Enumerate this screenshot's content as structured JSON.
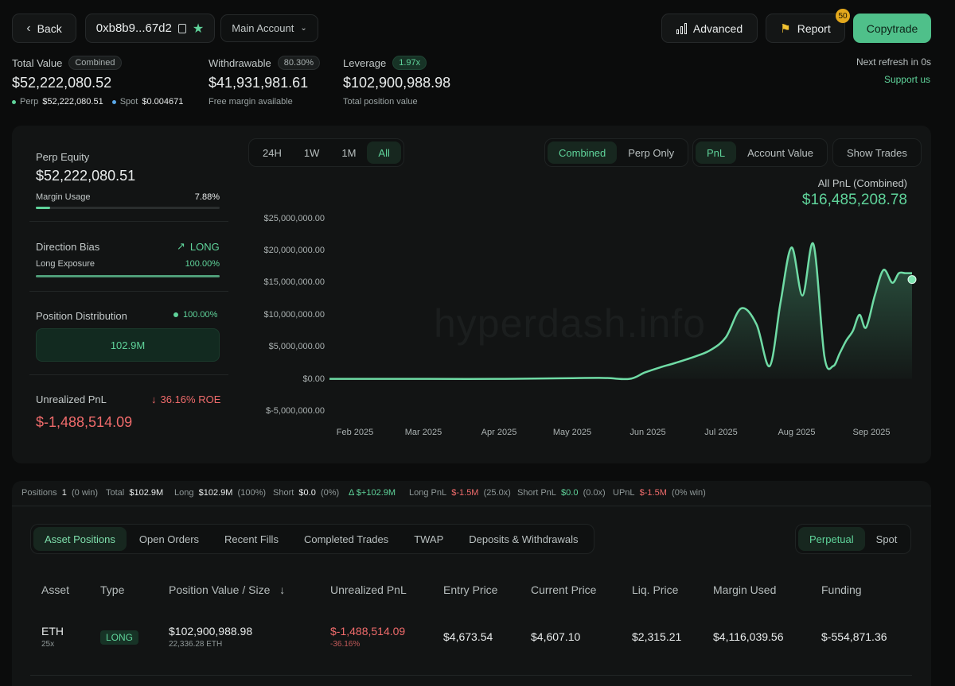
{
  "header": {
    "back_label": "Back",
    "address": "0xb8b9...67d2",
    "account_select": "Main Account",
    "advanced_label": "Advanced",
    "report_label": "Report",
    "report_badge": "50",
    "copytrade_label": "Copytrade",
    "next_refresh": "Next refresh in 0s",
    "support": "Support us"
  },
  "summary": {
    "total_value_label": "Total Value",
    "total_value_tag": "Combined",
    "total_value": "$52,222,080.52",
    "perp_label": "Perp",
    "perp_value": "$52,222,080.51",
    "spot_label": "Spot",
    "spot_value": "$0.004671",
    "withdrawable_label": "Withdrawable",
    "withdrawable_pct": "80.30%",
    "withdrawable_value": "$41,931,981.61",
    "withdrawable_sub": "Free margin available",
    "leverage_label": "Leverage",
    "leverage_tag": "1.97x",
    "leverage_value": "$102,900,988.98",
    "leverage_sub": "Total position value"
  },
  "left_panel": {
    "perp_equity_label": "Perp Equity",
    "perp_equity_value": "$52,222,080.51",
    "margin_usage_label": "Margin Usage",
    "margin_usage_value": "7.88%",
    "margin_usage_fraction": 0.0788,
    "direction_bias_label": "Direction Bias",
    "direction_bias_value": "LONG",
    "long_exposure_label": "Long Exposure",
    "long_exposure_value": "100.00%",
    "long_exposure_fraction": 1.0,
    "position_dist_label": "Position Distribution",
    "position_dist_pct": "100.00%",
    "position_dist_value": "102.9M",
    "upnl_label": "Unrealized PnL",
    "upnl_roe": "36.16% ROE",
    "upnl_value": "$-1,488,514.09"
  },
  "chart_controls": {
    "ranges": [
      "24H",
      "1W",
      "1M",
      "All"
    ],
    "active_range": "All",
    "modes": [
      "Combined",
      "Perp Only"
    ],
    "active_mode": "Combined",
    "metrics": [
      "PnL",
      "Account Value"
    ],
    "active_metric": "PnL",
    "show_trades": "Show Trades"
  },
  "chart_data": {
    "type": "area",
    "title": "All PnL (Combined)",
    "headline_value": "$16,485,208.78",
    "watermark": "hyperdash.info",
    "ylim": [
      -5000000,
      25000000
    ],
    "y_ticks": [
      "$25,000,000.00",
      "$20,000,000.00",
      "$15,000,000.00",
      "$10,000,000.00",
      "$5,000,000.00",
      "$0.00",
      "$-5,000,000.00"
    ],
    "x_ticks": [
      "Feb 2025",
      "Mar 2025",
      "Apr 2025",
      "May 2025",
      "Jun 2025",
      "Jul 2025",
      "Aug 2025",
      "Sep 2025"
    ],
    "series": [
      {
        "x": [
          "2025-01-15",
          "2025-02-01",
          "2025-03-01",
          "2025-04-01",
          "2025-05-01",
          "2025-05-20",
          "2025-06-01",
          "2025-06-08",
          "2025-06-15",
          "2025-06-22",
          "2025-07-01",
          "2025-07-08",
          "2025-07-15",
          "2025-07-22",
          "2025-07-29",
          "2025-08-04",
          "2025-08-09",
          "2025-08-14",
          "2025-08-19",
          "2025-08-24",
          "2025-08-29",
          "2025-09-02",
          "2025-09-05",
          "2025-09-08",
          "2025-09-11",
          "2025-09-14",
          "2025-09-17",
          "2025-09-21",
          "2025-09-25",
          "2025-09-29",
          "2025-10-02",
          "2025-10-05",
          "2025-10-08"
        ],
        "values": [
          0,
          0,
          0,
          0,
          100000,
          150000,
          0,
          1000000,
          1800000,
          2500000,
          3500000,
          4500000,
          6500000,
          11000000,
          8500000,
          2000000,
          12000000,
          20500000,
          13000000,
          21000000,
          3500000,
          2000000,
          4000000,
          6000000,
          7500000,
          10000000,
          8000000,
          13000000,
          17000000,
          15000000,
          16485208.78,
          16485208.78,
          16485208.78
        ]
      }
    ]
  },
  "positions_bar": {
    "positions_label": "Positions",
    "positions_value": "1",
    "positions_sub": "(0 win)",
    "total_label": "Total",
    "total_value": "$102.9M",
    "long_label": "Long",
    "long_value": "$102.9M",
    "long_sub": "(100%)",
    "short_label": "Short",
    "short_value": "$0.0",
    "short_sub": "(0%)",
    "delta_value": "Δ $+102.9M",
    "longpnl_label": "Long PnL",
    "longpnl_value": "$-1.5M",
    "longpnl_sub": "(25.0x)",
    "shortpnl_label": "Short PnL",
    "shortpnl_value": "$0.0",
    "shortpnl_sub": "(0.0x)",
    "upnl_label": "UPnL",
    "upnl_value": "$-1.5M",
    "upnl_sub": "(0% win)"
  },
  "tabs": {
    "items": [
      "Asset Positions",
      "Open Orders",
      "Recent Fills",
      "Completed Trades",
      "TWAP",
      "Deposits & Withdrawals"
    ],
    "active": "Asset Positions",
    "market": [
      "Perpetual",
      "Spot"
    ],
    "active_market": "Perpetual"
  },
  "table": {
    "headers": [
      "Asset",
      "Type",
      "Position Value / Size",
      "Unrealized PnL",
      "Entry Price",
      "Current Price",
      "Liq. Price",
      "Margin Used",
      "Funding"
    ],
    "rows": [
      {
        "asset": "ETH",
        "leverage": "25x",
        "type": "LONG",
        "position_value": "$102,900,988.98",
        "size": "22,336.28 ETH",
        "upnl": "$-1,488,514.09",
        "upnl_pct": "-36.16%",
        "entry": "$4,673.54",
        "current": "$4,607.10",
        "liq": "$2,315.21",
        "margin": "$4,116,039.56",
        "funding": "$-554,871.36"
      }
    ]
  }
}
